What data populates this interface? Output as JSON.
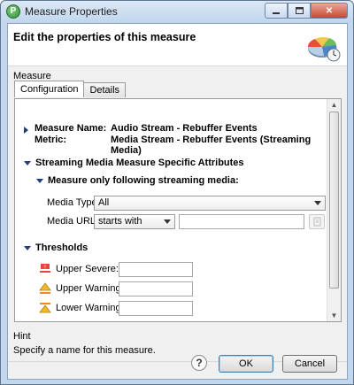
{
  "window": {
    "title": "Measure Properties"
  },
  "header": {
    "title": "Edit the properties of this measure"
  },
  "group": {
    "label": "Measure"
  },
  "tabs": [
    {
      "label": "Configuration",
      "active": true
    },
    {
      "label": "Details",
      "active": false
    }
  ],
  "summary": {
    "measure_name_label": "Measure Name:",
    "measure_name_value": "Audio Stream - Rebuffer Events",
    "metric_label": "Metric:",
    "metric_value": "Media Stream - Rebuffer Events (Streaming Media)"
  },
  "sections": {
    "specific": "Streaming Media Measure Specific Attributes",
    "only_following": "Measure only following streaming media:",
    "thresholds": "Thresholds"
  },
  "media_type": {
    "label": "Media Type",
    "value": "All"
  },
  "media_url": {
    "label": "Media URL:",
    "operator": "starts with",
    "value": ""
  },
  "thresholds": [
    {
      "label": "Upper Severe:",
      "value": "",
      "icon": "severe-icon"
    },
    {
      "label": "Upper Warning:",
      "value": "",
      "icon": "warning-icon"
    },
    {
      "label": "Lower Warning:",
      "value": "",
      "icon": "lower-warning-icon"
    }
  ],
  "hint": {
    "title": "Hint",
    "text": "Specify a name for this measure."
  },
  "buttons": {
    "help": "?",
    "ok": "OK",
    "cancel": "Cancel"
  },
  "colors": {
    "accent": "#1f3f7a",
    "titlebar": "#c3d7ec",
    "close": "#c9482f"
  }
}
